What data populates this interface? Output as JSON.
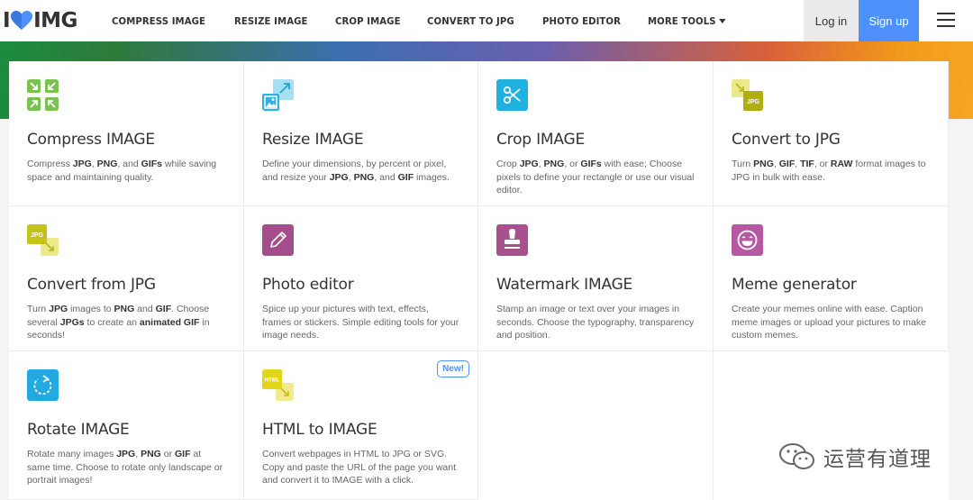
{
  "logo": {
    "left": "I",
    "right": "IMG"
  },
  "nav": [
    "COMPRESS IMAGE",
    "RESIZE IMAGE",
    "CROP IMAGE",
    "CONVERT TO JPG",
    "PHOTO EDITOR",
    "MORE TOOLS"
  ],
  "auth": {
    "login": "Log in",
    "signup": "Sign up"
  },
  "colors": {
    "accent": "#4d90fe",
    "compress": "#79c24f",
    "resize": "#5bc3e6",
    "crop": "#1fb2e0",
    "convert": "#c5c21b",
    "edit": "#a34e8b",
    "watermark": "#a9508f",
    "meme": "#b559a2",
    "rotate": "#21a9e0",
    "html": "#e3d51a"
  },
  "tools": [
    {
      "title": "Compress IMAGE",
      "icon": "compress-icon",
      "desc": [
        [
          "Compress ",
          false
        ],
        [
          "JPG",
          true
        ],
        [
          ", ",
          false
        ],
        [
          "PNG",
          true
        ],
        [
          ", and ",
          false
        ],
        [
          "GIFs",
          true
        ],
        [
          " while saving space and maintaining quality.",
          false
        ]
      ]
    },
    {
      "title": "Resize IMAGE",
      "icon": "resize-icon",
      "desc": [
        [
          "Define your dimensions, by percent or pixel, and resize your ",
          false
        ],
        [
          "JPG",
          true
        ],
        [
          ", ",
          false
        ],
        [
          "PNG",
          true
        ],
        [
          ", and ",
          false
        ],
        [
          "GIF",
          true
        ],
        [
          " images.",
          false
        ]
      ]
    },
    {
      "title": "Crop IMAGE",
      "icon": "crop-scissors-icon",
      "desc": [
        [
          "Crop ",
          false
        ],
        [
          "JPG",
          true
        ],
        [
          ", ",
          false
        ],
        [
          "PNG",
          true
        ],
        [
          ", or ",
          false
        ],
        [
          "GIFs",
          true
        ],
        [
          " with ease; Choose pixels to define your rectangle or use our visual editor.",
          false
        ]
      ]
    },
    {
      "title": "Convert to JPG",
      "icon": "convert-to-jpg-icon",
      "iconLabel": "JPG",
      "desc": [
        [
          "Turn ",
          false
        ],
        [
          "PNG",
          true
        ],
        [
          ", ",
          false
        ],
        [
          "GIF",
          true
        ],
        [
          ", ",
          false
        ],
        [
          "TIF",
          true
        ],
        [
          ", or ",
          false
        ],
        [
          "RAW",
          true
        ],
        [
          " format images to JPG in bulk with ease.",
          false
        ]
      ]
    },
    {
      "title": "Convert from JPG",
      "icon": "convert-from-jpg-icon",
      "iconLabel": "JPG",
      "desc": [
        [
          "Turn ",
          false
        ],
        [
          "JPG",
          true
        ],
        [
          " images to ",
          false
        ],
        [
          "PNG",
          true
        ],
        [
          " and ",
          false
        ],
        [
          "GIF",
          true
        ],
        [
          ". Choose several ",
          false
        ],
        [
          "JPGs",
          true
        ],
        [
          " to create an ",
          false
        ],
        [
          "animated GIF",
          true
        ],
        [
          " in seconds!",
          false
        ]
      ]
    },
    {
      "title": "Photo editor",
      "icon": "pencil-icon",
      "desc": [
        [
          "Spice up your pictures with text, effects, frames or stickers. Simple editing tools for your image needs.",
          false
        ]
      ]
    },
    {
      "title": "Watermark IMAGE",
      "icon": "stamp-icon",
      "desc": [
        [
          "Stamp an image or text over your images in seconds. Choose the typography, transparency and position.",
          false
        ]
      ]
    },
    {
      "title": "Meme generator",
      "icon": "laughing-face-icon",
      "desc": [
        [
          "Create your memes online with ease. Caption meme images or upload your pictures to make custom memes.",
          false
        ]
      ]
    },
    {
      "title": "Rotate IMAGE",
      "icon": "rotate-icon",
      "desc": [
        [
          "Rotate many images ",
          false
        ],
        [
          "JPG",
          true
        ],
        [
          ", ",
          false
        ],
        [
          "PNG",
          true
        ],
        [
          " or ",
          false
        ],
        [
          "GIF",
          true
        ],
        [
          " at same time. Choose to rotate only landscape or portrait images!",
          false
        ]
      ]
    },
    {
      "title": "HTML to IMAGE",
      "icon": "html-to-image-icon",
      "iconLabel": "HTML",
      "badge": "New!",
      "desc": [
        [
          "Convert webpages in HTML to JPG or SVG. Copy and paste the URL of the page you want and convert it to IMAGE with a click.",
          false
        ]
      ]
    }
  ],
  "watermark": "运营有道理"
}
